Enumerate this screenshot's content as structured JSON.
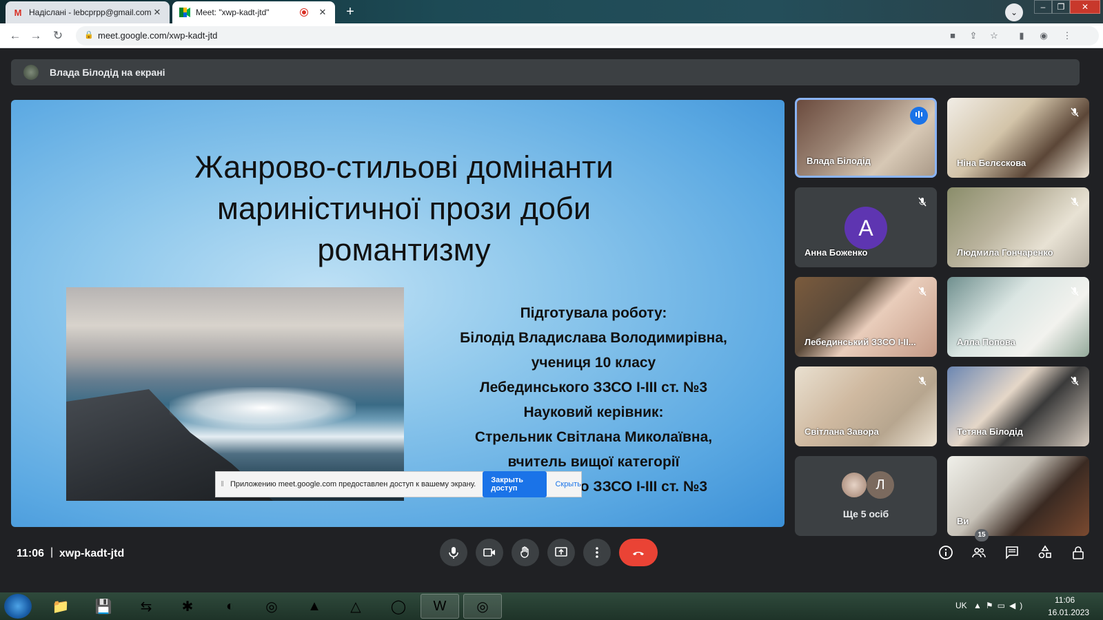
{
  "browser": {
    "tabs": [
      {
        "title": "Надіслані - lebcprpp@gmail.com",
        "favicon": "gmail-icon"
      },
      {
        "title": "Meet: \"xwp-kadt-jtd\"",
        "favicon": "meet-icon"
      }
    ],
    "url": "meet.google.com/xwp-kadt-jtd"
  },
  "presenter": {
    "text": "Влада Білодід на екрані"
  },
  "slide": {
    "title_line1": "Жанрово-стильові домінанти",
    "title_line2": "мариністичної прози доби",
    "title_line3": "романтизму",
    "credits": [
      "Підготувала роботу:",
      "Білодід Владислава Володимирівна,",
      "учениця 10 класу",
      "Лебединського ЗЗСО І-ІІІ ст. №3",
      "Науковий керівник:",
      "Стрельник Світлана Миколаївна,",
      "вчитель вищої категорії",
      "Лебединського ЗЗСО І-ІІІ ст. №3"
    ]
  },
  "share_notice": {
    "text": "Приложению meet.google.com предоставлен доступ к вашему экрану.",
    "stop_label": "Закрыть доступ",
    "hide_label": "Скрыть"
  },
  "participants": [
    {
      "name": "Влада Білодід"
    },
    {
      "name": "Ніна Белєскова"
    },
    {
      "name": "Анна Боженко",
      "initial": "A"
    },
    {
      "name": "Людмила Гончаренко"
    },
    {
      "name": "Лебединський ЗЗСО І-ІІ..."
    },
    {
      "name": "Алла Попова"
    },
    {
      "name": "Світлана Завора"
    },
    {
      "name": "Тетяна Білодід"
    },
    {
      "name": "Ще 5 осіб",
      "initial": "Л"
    },
    {
      "name": "Ви"
    }
  ],
  "meeting": {
    "time": "11:06",
    "separator": "|",
    "code": "xwp-kadt-jtd",
    "people_count": "15"
  },
  "taskbar": {
    "lang": "UK",
    "time": "11:06",
    "date": "16.01.2023"
  },
  "colors": {
    "accent": "#1a73e8",
    "end_call": "#ea4335",
    "avatar_purple": "#5e35b1"
  }
}
